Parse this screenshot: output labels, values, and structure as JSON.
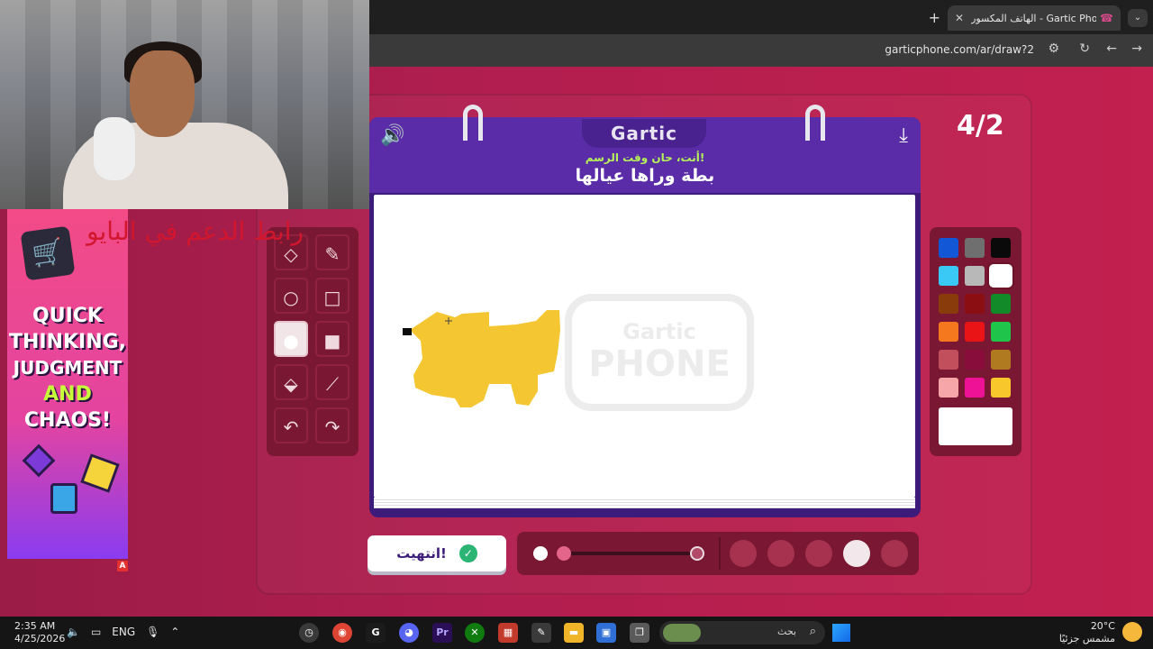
{
  "browser": {
    "tab_title": "الهاتف المكسور - Gartic Phone",
    "tab_close": "✕",
    "new_tab": "+",
    "url": "garticphone.com/ar/draw?2"
  },
  "game": {
    "logo": "Gartic",
    "subtitle": "أنت، حان وقت الرسم!",
    "phrase": "بطة وراها عيالها",
    "round": "4/2",
    "done_label": "انتهيت!",
    "watermark_top": "Gartic",
    "watermark_bottom": "PHONE",
    "brush_size_level": 0.0
  },
  "tools": [
    {
      "name": "eraser-tool",
      "icon": "eraser-icon",
      "glyph": "◇"
    },
    {
      "name": "pencil-tool",
      "icon": "pencil-icon",
      "glyph": "✎"
    },
    {
      "name": "ellipse-outline-tool",
      "icon": "circle-outline-icon",
      "glyph": "○"
    },
    {
      "name": "rectangle-outline-tool",
      "icon": "square-outline-icon",
      "glyph": "□"
    },
    {
      "name": "ellipse-fill-tool",
      "icon": "circle-filled-icon",
      "glyph": "●"
    },
    {
      "name": "rectangle-fill-tool",
      "icon": "square-filled-icon",
      "glyph": "■"
    },
    {
      "name": "fill-bucket-tool",
      "icon": "bucket-icon",
      "glyph": "⬙"
    },
    {
      "name": "line-tool",
      "icon": "line-icon",
      "glyph": "⟋"
    },
    {
      "name": "undo-tool",
      "icon": "undo-icon",
      "glyph": "↶"
    },
    {
      "name": "redo-tool",
      "icon": "redo-icon",
      "glyph": "↷"
    }
  ],
  "palette": [
    "#1257d6",
    "#6f6f6f",
    "#0a0a0a",
    "#3ac8f5",
    "#b8b8b8",
    "#ffffff",
    "#8a3b0c",
    "#8b0e12",
    "#138a2a",
    "#f5781f",
    "#e81416",
    "#1ec54a",
    "#c2505c",
    "#880d3a",
    "#b07a20",
    "#f6a5a9",
    "#ee1396",
    "#f7c72b"
  ],
  "palette_selected": "#ffffff",
  "drawing_color": "#f4c631",
  "overlay": {
    "support_text": "رابط الدعم في البايو"
  },
  "ad": {
    "line1": "QUICK",
    "line2": "THINKING,",
    "line3": "JUDGMENT",
    "line4": "AND",
    "line5": "CHAOS!",
    "badge": "A"
  },
  "taskbar": {
    "time": "2:35 AM",
    "date": "4/25/2026",
    "lang": "ENG",
    "search_label": "بحث",
    "weather_temp": "20°C",
    "weather_desc": "مشمس جزئيًا"
  }
}
